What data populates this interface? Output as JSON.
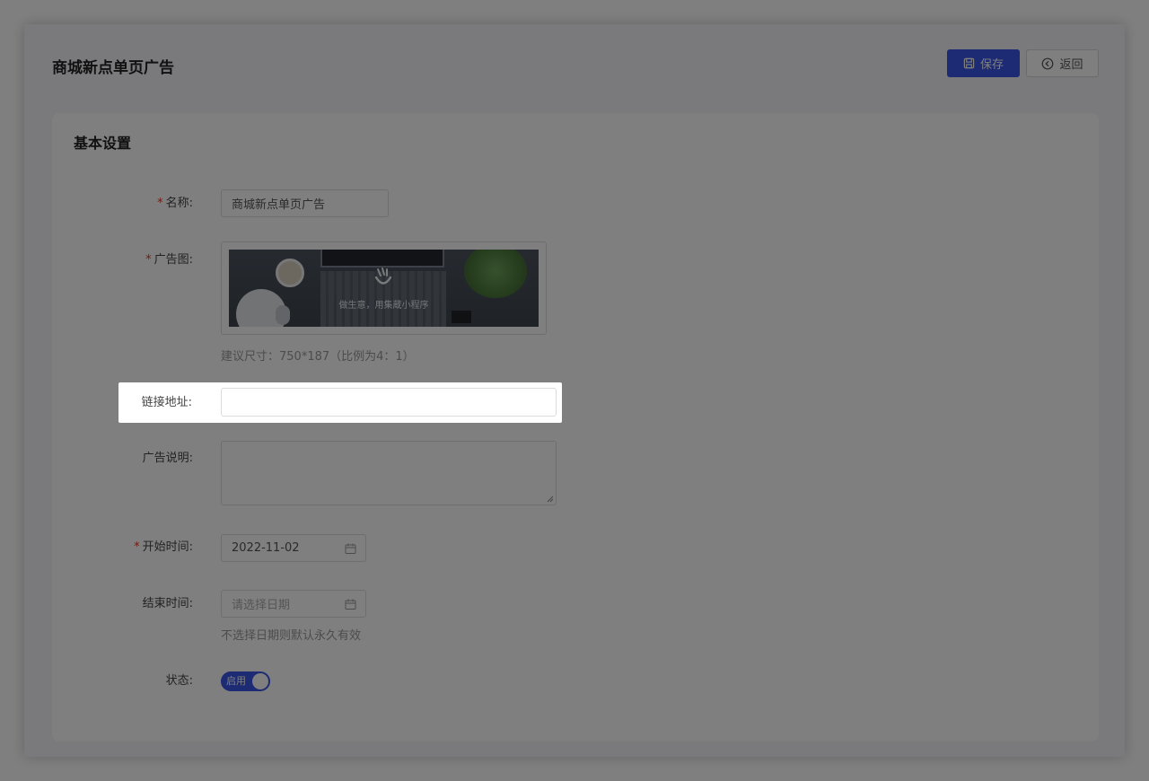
{
  "page": {
    "title": "商城新点单页广告"
  },
  "toolbar": {
    "save_label": "保存",
    "back_label": "返回"
  },
  "card": {
    "title": "基本设置"
  },
  "form": {
    "name": {
      "label": "名称:",
      "value": "商城新点单页广告",
      "required": true
    },
    "ad_image": {
      "label": "广告图:",
      "required": true,
      "banner_text": "做生意，用集蔵小程序",
      "hint": "建议尺寸：750*187（比例为4：1）"
    },
    "link": {
      "label": "链接地址:",
      "value": ""
    },
    "description": {
      "label": "广告说明:",
      "value": ""
    },
    "start_time": {
      "label": "开始时间:",
      "value": "2022-11-02",
      "required": true
    },
    "end_time": {
      "label": "结束时间:",
      "placeholder": "请选择日期",
      "hint": "不选择日期则默认永久有效"
    },
    "status": {
      "label": "状态:",
      "switch_label": "启用",
      "enabled": true
    }
  },
  "colors": {
    "primary": "#3956e6",
    "required": "#e0392b"
  }
}
